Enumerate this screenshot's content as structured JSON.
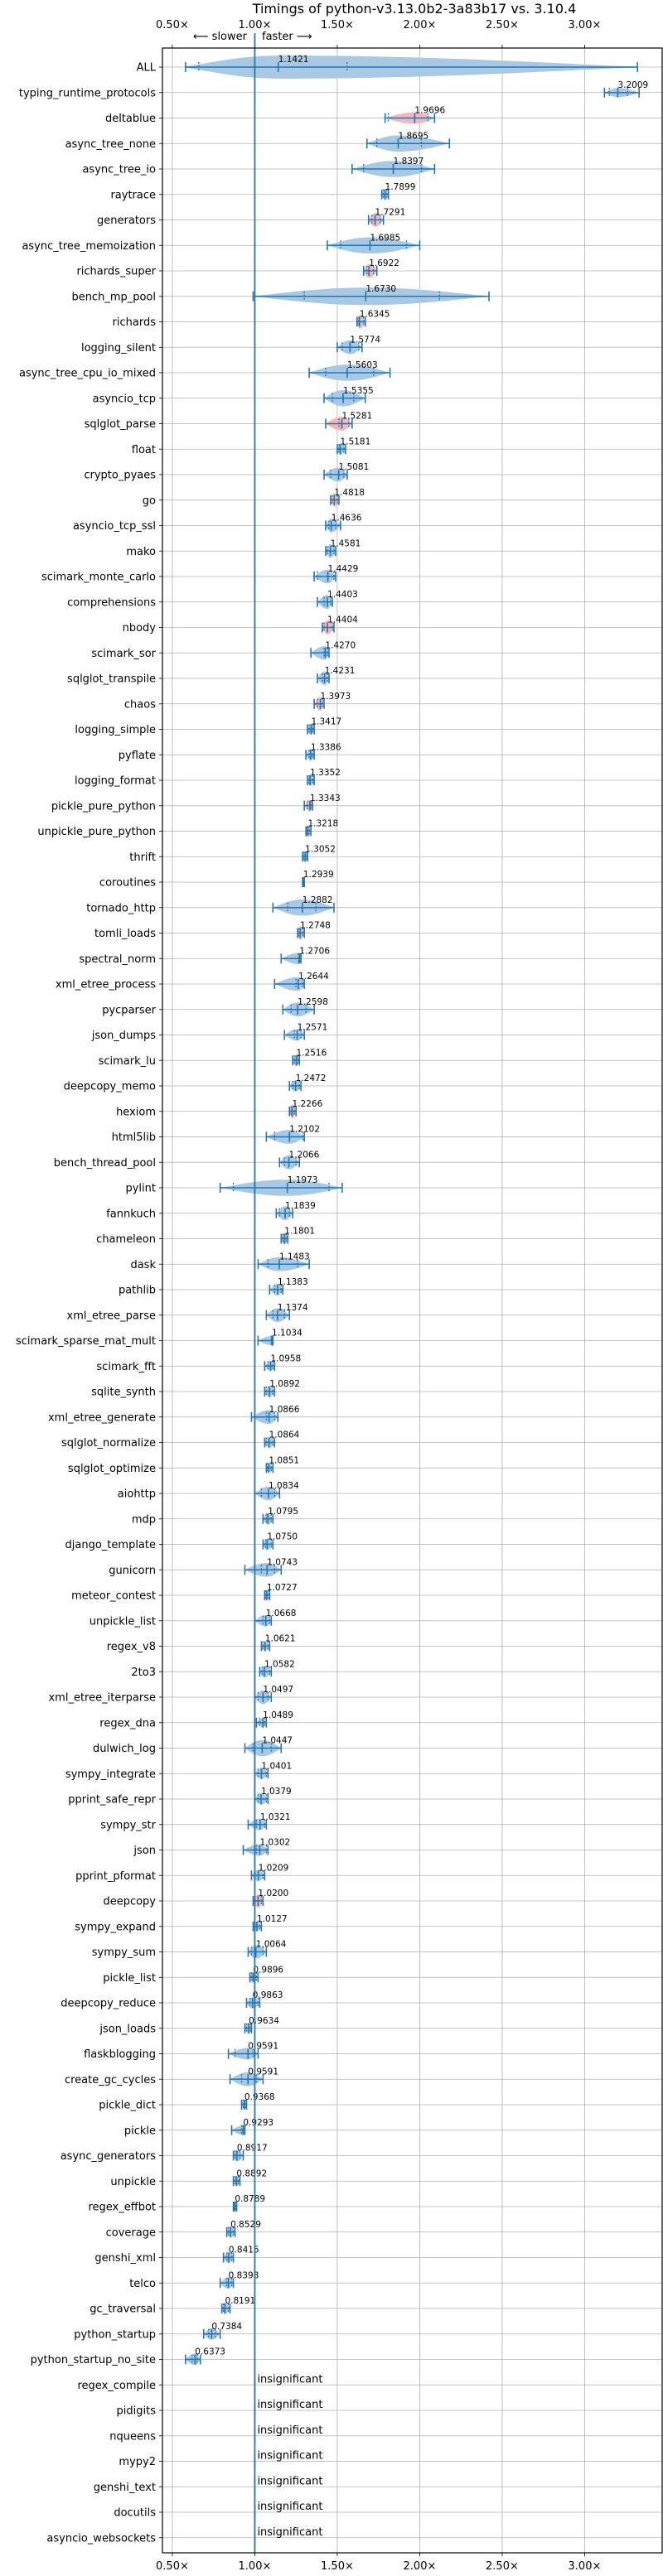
{
  "chart_data": {
    "type": "violin",
    "title": "Timings of python-v3.13.0b2-3a83b17 vs. 3.10.4",
    "xlabel": "",
    "ylabel": "",
    "xlim": [
      0.44,
      3.47
    ],
    "xticks": [
      0.5,
      1.0,
      1.5,
      2.0,
      2.5,
      3.0
    ],
    "xtick_labels": [
      "0.50×",
      "1.00×",
      "1.50×",
      "2.00×",
      "2.50×",
      "3.00×"
    ],
    "direction_labels": {
      "slower": "⟵ slower",
      "faster": "faster ⟶"
    },
    "reference_line": 1.0,
    "grid": true,
    "colors": {
      "faster": "#a9c8e3",
      "slower_variance": "#f7b6b8",
      "line": "#1f77b4"
    },
    "insignificant_text": "insignificant",
    "benchmarks": [
      {
        "name": "ALL",
        "median": 1.1421,
        "min": 0.58,
        "max": 3.32,
        "q1": 0.66,
        "q3": 1.56,
        "color": "blue",
        "spread": 1.0
      },
      {
        "name": "typing_runtime_protocols",
        "median": 3.2009,
        "min": 3.12,
        "max": 3.33,
        "q1": 3.15,
        "q3": 3.26,
        "color": "blue",
        "spread": 0.4
      },
      {
        "name": "deltablue",
        "median": 1.9696,
        "min": 1.79,
        "max": 2.09,
        "q1": 1.81,
        "q3": 2.05,
        "color": "red",
        "spread": 0.5
      },
      {
        "name": "async_tree_none",
        "median": 1.8695,
        "min": 1.68,
        "max": 2.18,
        "q1": 1.74,
        "q3": 2.01,
        "color": "blue",
        "spread": 0.7
      },
      {
        "name": "async_tree_io",
        "median": 1.8397,
        "min": 1.59,
        "max": 2.09,
        "q1": 1.66,
        "q3": 2.01,
        "color": "blue",
        "spread": 0.7
      },
      {
        "name": "raytrace",
        "median": 1.7899,
        "min": 1.77,
        "max": 1.81,
        "q1": 1.78,
        "q3": 1.8,
        "color": "red",
        "spread": 0.5
      },
      {
        "name": "generators",
        "median": 1.7291,
        "min": 1.69,
        "max": 1.78,
        "q1": 1.71,
        "q3": 1.76,
        "color": "red",
        "spread": 0.6
      },
      {
        "name": "async_tree_memoization",
        "median": 1.6985,
        "min": 1.44,
        "max": 2.0,
        "q1": 1.52,
        "q3": 1.92,
        "color": "blue",
        "spread": 0.7
      },
      {
        "name": "richards_super",
        "median": 1.6922,
        "min": 1.66,
        "max": 1.74,
        "q1": 1.68,
        "q3": 1.72,
        "color": "red",
        "spread": 0.6
      },
      {
        "name": "bench_mp_pool",
        "median": 1.673,
        "min": 0.99,
        "max": 2.42,
        "q1": 1.3,
        "q3": 2.12,
        "color": "blue",
        "spread": 0.75
      },
      {
        "name": "richards",
        "median": 1.6345,
        "min": 1.62,
        "max": 1.67,
        "q1": 1.63,
        "q3": 1.66,
        "color": "red",
        "spread": 0.6
      },
      {
        "name": "logging_silent",
        "median": 1.5774,
        "min": 1.5,
        "max": 1.65,
        "q1": 1.53,
        "q3": 1.63,
        "color": "blue",
        "spread": 0.6
      },
      {
        "name": "async_tree_cpu_io_mixed",
        "median": 1.5603,
        "min": 1.33,
        "max": 1.82,
        "q1": 1.43,
        "q3": 1.72,
        "color": "blue",
        "spread": 0.7
      },
      {
        "name": "asyncio_tcp",
        "median": 1.5355,
        "min": 1.42,
        "max": 1.67,
        "q1": 1.47,
        "q3": 1.6,
        "color": "blue",
        "spread": 0.7
      },
      {
        "name": "sqlglot_parse",
        "median": 1.5281,
        "min": 1.43,
        "max": 1.59,
        "q1": 1.51,
        "q3": 1.57,
        "color": "red",
        "spread": 0.6
      },
      {
        "name": "float",
        "median": 1.5181,
        "min": 1.5,
        "max": 1.55,
        "q1": 1.51,
        "q3": 1.54,
        "color": "blue",
        "spread": 0.5
      },
      {
        "name": "crypto_pyaes",
        "median": 1.5081,
        "min": 1.42,
        "max": 1.56,
        "q1": 1.46,
        "q3": 1.54,
        "color": "blue",
        "spread": 0.6
      },
      {
        "name": "go",
        "median": 1.4818,
        "min": 1.46,
        "max": 1.51,
        "q1": 1.47,
        "q3": 1.5,
        "color": "red",
        "spread": 0.6
      },
      {
        "name": "asyncio_tcp_ssl",
        "median": 1.4636,
        "min": 1.43,
        "max": 1.52,
        "q1": 1.45,
        "q3": 1.49,
        "color": "blue",
        "spread": 0.6
      },
      {
        "name": "mako",
        "median": 1.4581,
        "min": 1.43,
        "max": 1.49,
        "q1": 1.44,
        "q3": 1.48,
        "color": "blue",
        "spread": 0.6
      },
      {
        "name": "scimark_monte_carlo",
        "median": 1.4429,
        "min": 1.36,
        "max": 1.49,
        "q1": 1.38,
        "q3": 1.48,
        "color": "blue",
        "spread": 0.6
      },
      {
        "name": "comprehensions",
        "median": 1.4403,
        "min": 1.38,
        "max": 1.47,
        "q1": 1.42,
        "q3": 1.46,
        "color": "blue",
        "spread": 0.6
      },
      {
        "name": "nbody",
        "median": 1.4404,
        "min": 1.41,
        "max": 1.48,
        "q1": 1.42,
        "q3": 1.47,
        "color": "red",
        "spread": 0.6
      },
      {
        "name": "scimark_sor",
        "median": 1.427,
        "min": 1.34,
        "max": 1.45,
        "q1": 1.42,
        "q3": 1.44,
        "color": "blue",
        "spread": 0.6
      },
      {
        "name": "sqlglot_transpile",
        "median": 1.4231,
        "min": 1.38,
        "max": 1.45,
        "q1": 1.41,
        "q3": 1.44,
        "color": "blue",
        "spread": 0.6
      },
      {
        "name": "chaos",
        "median": 1.3973,
        "min": 1.36,
        "max": 1.42,
        "q1": 1.38,
        "q3": 1.41,
        "color": "red",
        "spread": 0.6
      },
      {
        "name": "logging_simple",
        "median": 1.3417,
        "min": 1.32,
        "max": 1.36,
        "q1": 1.33,
        "q3": 1.35,
        "color": "blue",
        "spread": 0.5
      },
      {
        "name": "pyflate",
        "median": 1.3386,
        "min": 1.31,
        "max": 1.36,
        "q1": 1.33,
        "q3": 1.35,
        "color": "blue",
        "spread": 0.5
      },
      {
        "name": "logging_format",
        "median": 1.3352,
        "min": 1.32,
        "max": 1.36,
        "q1": 1.33,
        "q3": 1.35,
        "color": "blue",
        "spread": 0.5
      },
      {
        "name": "pickle_pure_python",
        "median": 1.3343,
        "min": 1.3,
        "max": 1.35,
        "q1": 1.32,
        "q3": 1.34,
        "color": "red",
        "spread": 0.5
      },
      {
        "name": "unpickle_pure_python",
        "median": 1.3218,
        "min": 1.31,
        "max": 1.34,
        "q1": 1.315,
        "q3": 1.33,
        "color": "red",
        "spread": 0.5
      },
      {
        "name": "thrift",
        "median": 1.3052,
        "min": 1.29,
        "max": 1.32,
        "q1": 1.295,
        "q3": 1.315,
        "color": "blue",
        "spread": 0.5
      },
      {
        "name": "coroutines",
        "median": 1.2939,
        "min": 1.29,
        "max": 1.3,
        "q1": 1.29,
        "q3": 1.3,
        "color": "red",
        "spread": 0.4
      },
      {
        "name": "tornado_http",
        "median": 1.2882,
        "min": 1.11,
        "max": 1.48,
        "q1": 1.2,
        "q3": 1.37,
        "color": "blue",
        "spread": 0.7
      },
      {
        "name": "tomli_loads",
        "median": 1.2748,
        "min": 1.26,
        "max": 1.3,
        "q1": 1.265,
        "q3": 1.29,
        "color": "red",
        "spread": 0.6
      },
      {
        "name": "spectral_norm",
        "median": 1.2706,
        "min": 1.16,
        "max": 1.28,
        "q1": 1.265,
        "q3": 1.275,
        "color": "blue",
        "spread": 0.5
      },
      {
        "name": "xml_etree_process",
        "median": 1.2644,
        "min": 1.12,
        "max": 1.3,
        "q1": 1.25,
        "q3": 1.29,
        "color": "blue",
        "spread": 0.6
      },
      {
        "name": "pycparser",
        "median": 1.2598,
        "min": 1.17,
        "max": 1.36,
        "q1": 1.22,
        "q3": 1.31,
        "color": "blue",
        "spread": 0.6
      },
      {
        "name": "json_dumps",
        "median": 1.2571,
        "min": 1.18,
        "max": 1.3,
        "q1": 1.24,
        "q3": 1.28,
        "color": "blue",
        "spread": 0.5
      },
      {
        "name": "scimark_lu",
        "median": 1.2516,
        "min": 1.23,
        "max": 1.27,
        "q1": 1.24,
        "q3": 1.26,
        "color": "blue",
        "spread": 0.5
      },
      {
        "name": "deepcopy_memo",
        "median": 1.2472,
        "min": 1.21,
        "max": 1.28,
        "q1": 1.23,
        "q3": 1.27,
        "color": "blue",
        "spread": 0.5
      },
      {
        "name": "hexiom",
        "median": 1.2266,
        "min": 1.21,
        "max": 1.25,
        "q1": 1.22,
        "q3": 1.24,
        "color": "red",
        "spread": 0.6
      },
      {
        "name": "html5lib",
        "median": 1.2102,
        "min": 1.07,
        "max": 1.3,
        "q1": 1.12,
        "q3": 1.29,
        "color": "blue",
        "spread": 0.6
      },
      {
        "name": "bench_thread_pool",
        "median": 1.2066,
        "min": 1.15,
        "max": 1.27,
        "q1": 1.18,
        "q3": 1.25,
        "color": "blue",
        "spread": 0.6
      },
      {
        "name": "pylint",
        "median": 1.1973,
        "min": 0.79,
        "max": 1.53,
        "q1": 0.87,
        "q3": 1.45,
        "color": "blue",
        "spread": 0.7
      },
      {
        "name": "fannkuch",
        "median": 1.1839,
        "min": 1.13,
        "max": 1.23,
        "q1": 1.15,
        "q3": 1.21,
        "color": "blue",
        "spread": 0.6
      },
      {
        "name": "chameleon",
        "median": 1.1801,
        "min": 1.16,
        "max": 1.2,
        "q1": 1.17,
        "q3": 1.19,
        "color": "blue",
        "spread": 0.5
      },
      {
        "name": "dask",
        "median": 1.1483,
        "min": 1.02,
        "max": 1.33,
        "q1": 1.08,
        "q3": 1.26,
        "color": "blue",
        "spread": 0.6
      },
      {
        "name": "pathlib",
        "median": 1.1383,
        "min": 1.09,
        "max": 1.17,
        "q1": 1.12,
        "q3": 1.16,
        "color": "blue",
        "spread": 0.5
      },
      {
        "name": "xml_etree_parse",
        "median": 1.1374,
        "min": 1.07,
        "max": 1.21,
        "q1": 1.11,
        "q3": 1.18,
        "color": "blue",
        "spread": 0.6
      },
      {
        "name": "scimark_sparse_mat_mult",
        "median": 1.1034,
        "min": 1.02,
        "max": 1.11,
        "q1": 1.1,
        "q3": 1.11,
        "color": "blue",
        "spread": 0.4
      },
      {
        "name": "scimark_fft",
        "median": 1.0958,
        "min": 1.06,
        "max": 1.12,
        "q1": 1.08,
        "q3": 1.11,
        "color": "blue",
        "spread": 0.4
      },
      {
        "name": "sqlite_synth",
        "median": 1.0892,
        "min": 1.06,
        "max": 1.12,
        "q1": 1.07,
        "q3": 1.11,
        "color": "blue",
        "spread": 0.5
      },
      {
        "name": "xml_etree_generate",
        "median": 1.0866,
        "min": 0.98,
        "max": 1.14,
        "q1": 1.07,
        "q3": 1.12,
        "color": "blue",
        "spread": 0.6
      },
      {
        "name": "sqlglot_normalize",
        "median": 1.0864,
        "min": 1.06,
        "max": 1.12,
        "q1": 1.07,
        "q3": 1.11,
        "color": "blue",
        "spread": 0.5
      },
      {
        "name": "sqlglot_optimize",
        "median": 1.0851,
        "min": 1.07,
        "max": 1.11,
        "q1": 1.075,
        "q3": 1.1,
        "color": "blue",
        "spread": 0.4
      },
      {
        "name": "aiohttp",
        "median": 1.0834,
        "min": 1.0,
        "max": 1.15,
        "q1": 1.04,
        "q3": 1.12,
        "color": "blue",
        "spread": 0.6
      },
      {
        "name": "mdp",
        "median": 1.0795,
        "min": 1.05,
        "max": 1.11,
        "q1": 1.07,
        "q3": 1.1,
        "color": "blue",
        "spread": 0.5
      },
      {
        "name": "django_template",
        "median": 1.075,
        "min": 1.05,
        "max": 1.11,
        "q1": 1.065,
        "q3": 1.1,
        "color": "blue",
        "spread": 0.5
      },
      {
        "name": "gunicorn",
        "median": 1.0743,
        "min": 0.94,
        "max": 1.16,
        "q1": 1.04,
        "q3": 1.12,
        "color": "blue",
        "spread": 0.6
      },
      {
        "name": "meteor_contest",
        "median": 1.0727,
        "min": 1.06,
        "max": 1.09,
        "q1": 1.065,
        "q3": 1.085,
        "color": "blue",
        "spread": 0.4
      },
      {
        "name": "unpickle_list",
        "median": 1.0668,
        "min": 1.0,
        "max": 1.1,
        "q1": 1.05,
        "q3": 1.09,
        "color": "blue",
        "spread": 0.5
      },
      {
        "name": "regex_v8",
        "median": 1.0621,
        "min": 1.04,
        "max": 1.09,
        "q1": 1.05,
        "q3": 1.08,
        "color": "blue",
        "spread": 0.4
      },
      {
        "name": "2to3",
        "median": 1.0582,
        "min": 1.03,
        "max": 1.1,
        "q1": 1.045,
        "q3": 1.09,
        "color": "blue",
        "spread": 0.5
      },
      {
        "name": "xml_etree_iterparse",
        "median": 1.0497,
        "min": 1.0,
        "max": 1.1,
        "q1": 1.02,
        "q3": 1.08,
        "color": "blue",
        "spread": 0.6
      },
      {
        "name": "regex_dna",
        "median": 1.0489,
        "min": 1.01,
        "max": 1.07,
        "q1": 1.03,
        "q3": 1.06,
        "color": "blue",
        "spread": 0.4
      },
      {
        "name": "dulwich_log",
        "median": 1.0447,
        "min": 0.94,
        "max": 1.16,
        "q1": 0.99,
        "q3": 1.1,
        "color": "blue",
        "spread": 0.7
      },
      {
        "name": "sympy_integrate",
        "median": 1.0401,
        "min": 1.0,
        "max": 1.08,
        "q1": 1.02,
        "q3": 1.07,
        "color": "blue",
        "spread": 0.5
      },
      {
        "name": "pprint_safe_repr",
        "median": 1.0379,
        "min": 1.0,
        "max": 1.08,
        "q1": 1.02,
        "q3": 1.07,
        "color": "blue",
        "spread": 0.5
      },
      {
        "name": "sympy_str",
        "median": 1.0321,
        "min": 0.96,
        "max": 1.07,
        "q1": 1.01,
        "q3": 1.06,
        "color": "blue",
        "spread": 0.5
      },
      {
        "name": "json",
        "median": 1.0302,
        "min": 0.93,
        "max": 1.08,
        "q1": 1.01,
        "q3": 1.07,
        "color": "blue",
        "spread": 0.5
      },
      {
        "name": "pprint_pformat",
        "median": 1.0209,
        "min": 0.98,
        "max": 1.06,
        "q1": 1.0,
        "q3": 1.05,
        "color": "blue",
        "spread": 0.5
      },
      {
        "name": "deepcopy",
        "median": 1.02,
        "min": 0.99,
        "max": 1.05,
        "q1": 1.0,
        "q3": 1.04,
        "color": "red",
        "spread": 0.6
      },
      {
        "name": "sympy_expand",
        "median": 1.0127,
        "min": 0.99,
        "max": 1.04,
        "q1": 1.0,
        "q3": 1.03,
        "color": "blue",
        "spread": 0.4
      },
      {
        "name": "sympy_sum",
        "median": 1.0064,
        "min": 0.96,
        "max": 1.07,
        "q1": 0.98,
        "q3": 1.05,
        "color": "blue",
        "spread": 0.6
      },
      {
        "name": "pickle_list",
        "median": 0.9896,
        "min": 0.97,
        "max": 1.02,
        "q1": 0.98,
        "q3": 1.01,
        "color": "blue",
        "spread": 0.4
      },
      {
        "name": "deepcopy_reduce",
        "median": 0.9863,
        "min": 0.95,
        "max": 1.03,
        "q1": 0.97,
        "q3": 1.02,
        "color": "blue",
        "spread": 0.5
      },
      {
        "name": "json_loads",
        "median": 0.9634,
        "min": 0.94,
        "max": 0.98,
        "q1": 0.95,
        "q3": 0.975,
        "color": "blue",
        "spread": 0.5
      },
      {
        "name": "flaskblogging",
        "median": 0.9591,
        "min": 0.84,
        "max": 1.02,
        "q1": 0.88,
        "q3": 0.99,
        "color": "blue",
        "spread": 0.5
      },
      {
        "name": "create_gc_cycles",
        "median": 0.9591,
        "min": 0.85,
        "max": 1.05,
        "q1": 0.92,
        "q3": 1.01,
        "color": "blue",
        "spread": 0.6
      },
      {
        "name": "pickle_dict",
        "median": 0.9368,
        "min": 0.92,
        "max": 0.95,
        "q1": 0.93,
        "q3": 0.945,
        "color": "blue",
        "spread": 0.4
      },
      {
        "name": "pickle",
        "median": 0.9293,
        "min": 0.86,
        "max": 0.94,
        "q1": 0.92,
        "q3": 0.935,
        "color": "blue",
        "spread": 0.4
      },
      {
        "name": "async_generators",
        "median": 0.8917,
        "min": 0.87,
        "max": 0.93,
        "q1": 0.88,
        "q3": 0.91,
        "color": "blue",
        "spread": 0.5
      },
      {
        "name": "unpickle",
        "median": 0.8892,
        "min": 0.87,
        "max": 0.91,
        "q1": 0.88,
        "q3": 0.9,
        "color": "blue",
        "spread": 0.4
      },
      {
        "name": "regex_effbot",
        "median": 0.8789,
        "min": 0.87,
        "max": 0.89,
        "q1": 0.875,
        "q3": 0.885,
        "color": "blue",
        "spread": 0.4
      },
      {
        "name": "coverage",
        "median": 0.8529,
        "min": 0.83,
        "max": 0.88,
        "q1": 0.84,
        "q3": 0.87,
        "color": "blue",
        "spread": 0.5
      },
      {
        "name": "genshi_xml",
        "median": 0.8415,
        "min": 0.81,
        "max": 0.87,
        "q1": 0.83,
        "q3": 0.86,
        "color": "blue",
        "spread": 0.5
      },
      {
        "name": "telco",
        "median": 0.8398,
        "min": 0.79,
        "max": 0.87,
        "q1": 0.83,
        "q3": 0.86,
        "color": "blue",
        "spread": 0.5
      },
      {
        "name": "gc_traversal",
        "median": 0.8191,
        "min": 0.8,
        "max": 0.85,
        "q1": 0.81,
        "q3": 0.84,
        "color": "blue",
        "spread": 0.5
      },
      {
        "name": "python_startup",
        "median": 0.7384,
        "min": 0.69,
        "max": 0.79,
        "q1": 0.72,
        "q3": 0.76,
        "color": "blue",
        "spread": 0.5
      },
      {
        "name": "python_startup_no_site",
        "median": 0.6373,
        "min": 0.58,
        "max": 0.67,
        "q1": 0.62,
        "q3": 0.65,
        "color": "blue",
        "spread": 0.5
      },
      {
        "name": "regex_compile",
        "insignificant": true
      },
      {
        "name": "pidigits",
        "insignificant": true
      },
      {
        "name": "nqueens",
        "insignificant": true
      },
      {
        "name": "mypy2",
        "insignificant": true
      },
      {
        "name": "genshi_text",
        "insignificant": true
      },
      {
        "name": "docutils",
        "insignificant": true
      },
      {
        "name": "asyncio_websockets",
        "insignificant": true
      }
    ]
  }
}
